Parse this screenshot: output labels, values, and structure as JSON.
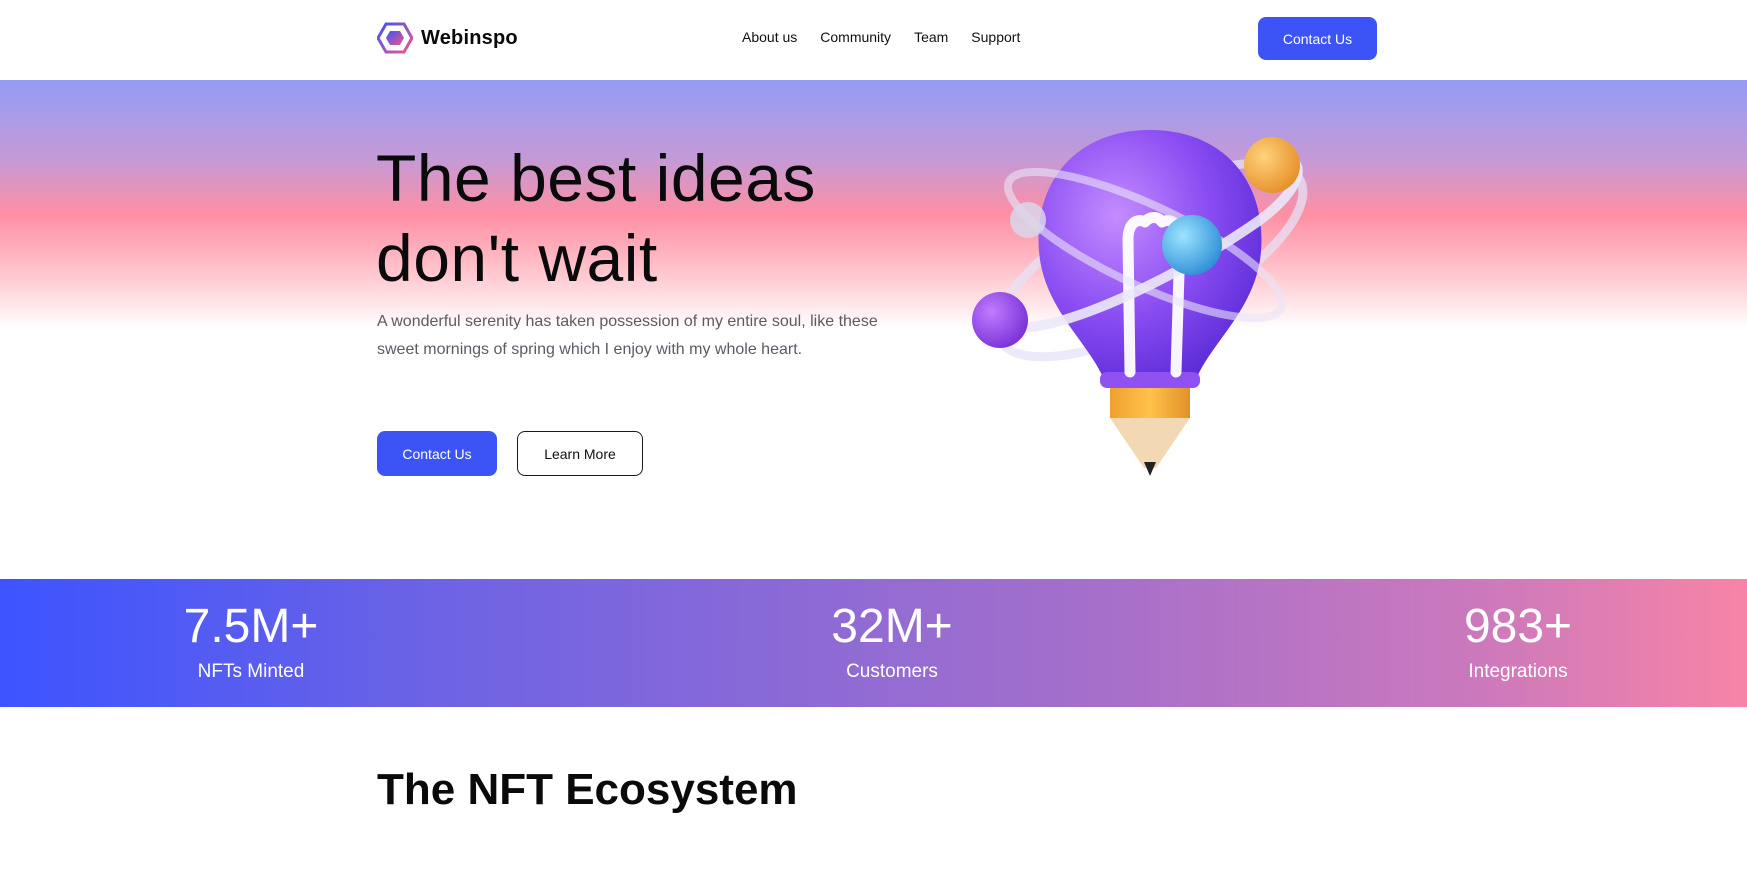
{
  "header": {
    "brand": "Webinspo",
    "nav": [
      {
        "label": "About us"
      },
      {
        "label": "Community"
      },
      {
        "label": "Team"
      },
      {
        "label": "Support"
      }
    ],
    "cta_label": "Contact Us"
  },
  "hero": {
    "title_line1": "The best ideas",
    "title_line2": "don't wait",
    "subtitle": "A wonderful serenity has taken possession of my entire soul, like these sweet mornings of spring which I enjoy with my whole heart.",
    "primary_button": "Contact Us",
    "secondary_button": "Learn More",
    "illustration_icon": "lightbulb-pencil-orbit-illustration"
  },
  "stats": [
    {
      "value": "7.5M+",
      "label": "NFTs Minted"
    },
    {
      "value": "32M+",
      "label": "Customers"
    },
    {
      "value": "983+",
      "label": "Integrations"
    }
  ],
  "section": {
    "title": "The NFT Ecosystem"
  },
  "colors": {
    "accent": "#3c54f6",
    "stats_gradient_start": "#3c54ff",
    "stats_gradient_end": "#f784a6",
    "hero_pink": "#ff8fa3",
    "hero_lavender": "#939cf6"
  }
}
